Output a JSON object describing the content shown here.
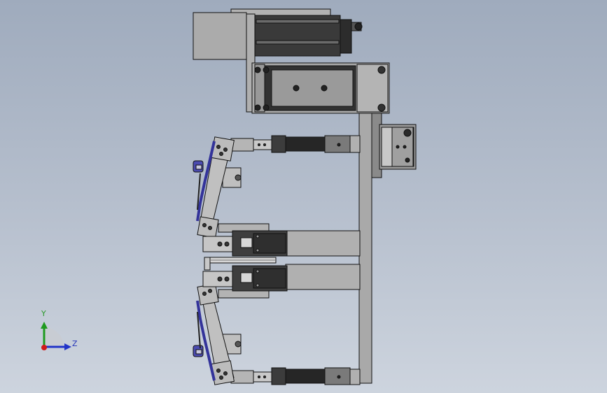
{
  "viewport": {
    "background_top": "#9fabbd",
    "background_bottom": "#cdd4de"
  },
  "triad": {
    "y_label": "Y",
    "z_label": "Z",
    "y_color": "#1f9a1f",
    "z_color": "#2234c8",
    "x_color": "#d01a1a"
  },
  "model": {
    "part_fill": "#a8a8a8",
    "part_light": "#c4c4c4",
    "part_dark": "#3c3c3c",
    "accent_blue": "#3a3a9a"
  }
}
